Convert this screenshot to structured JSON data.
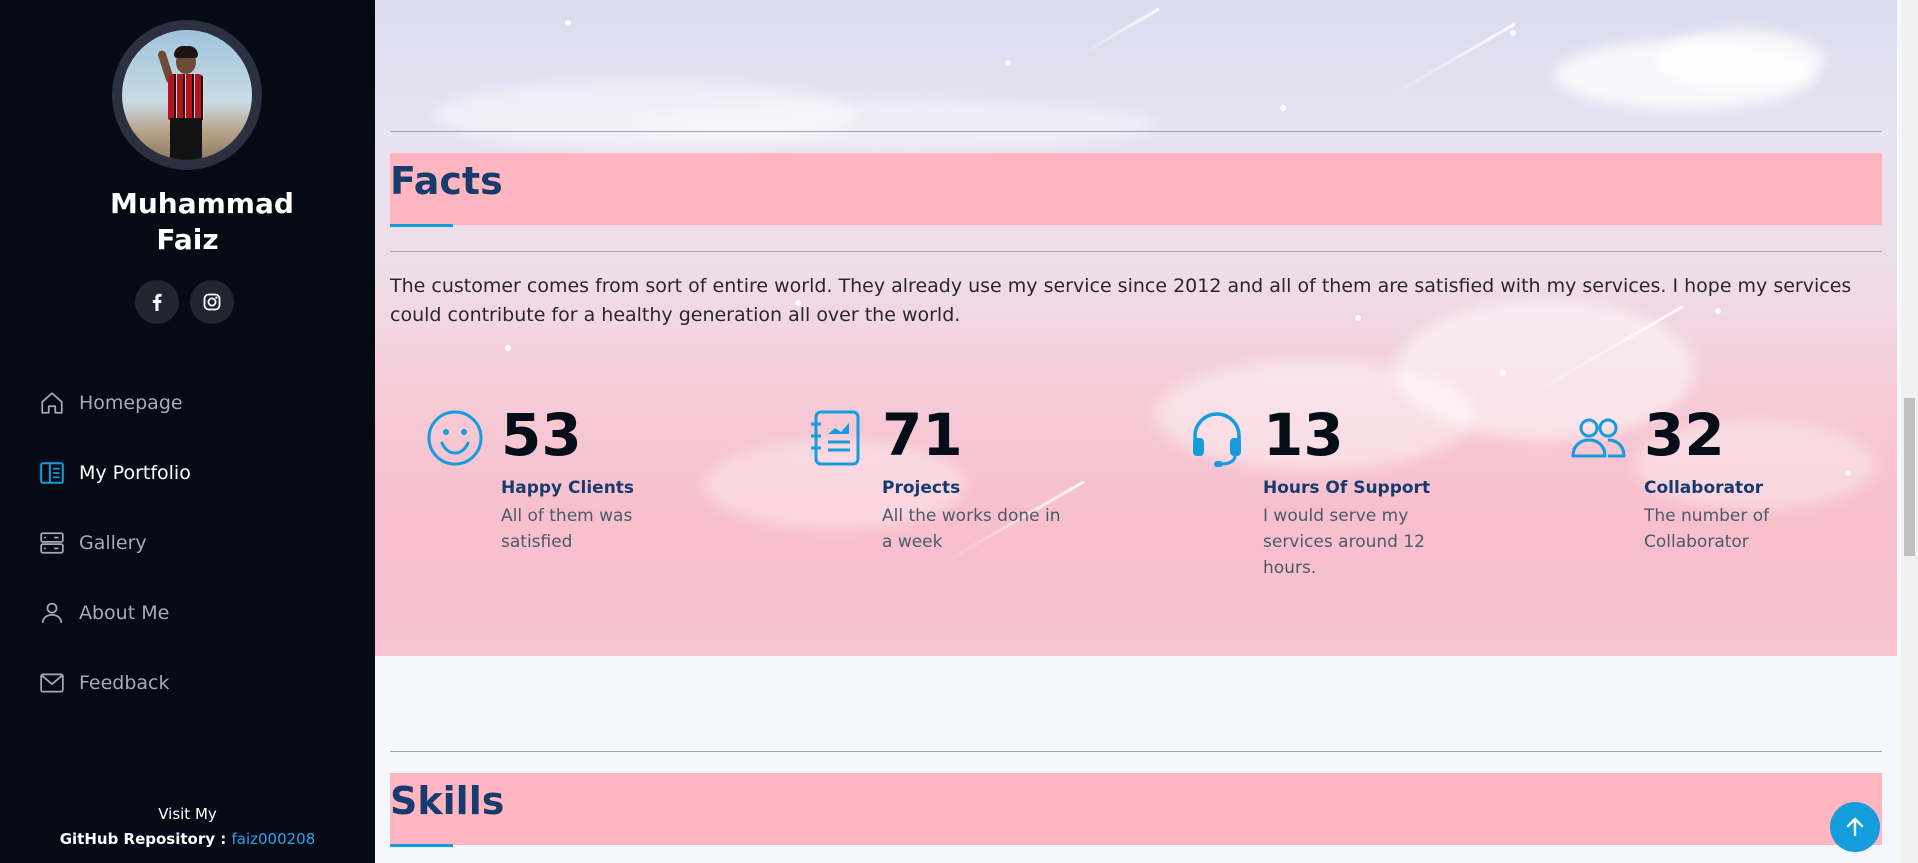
{
  "sidebar": {
    "name": "Muhammad Faiz",
    "social": [
      "facebook-icon",
      "instagram-icon"
    ],
    "nav": [
      {
        "label": "Homepage",
        "icon": "home-icon",
        "active": false
      },
      {
        "label": "My Portfolio",
        "icon": "portfolio-icon",
        "active": true
      },
      {
        "label": "Gallery",
        "icon": "gallery-icon",
        "active": false
      },
      {
        "label": "About Me",
        "icon": "person-icon",
        "active": false
      },
      {
        "label": "Feedback",
        "icon": "envelope-icon",
        "active": false
      }
    ],
    "footer": {
      "line1": "Visit My",
      "line2": "GitHub Repository :",
      "repo_link": "faiz000208"
    }
  },
  "facts": {
    "title": "Facts",
    "description": "The customer comes from sort of entire world. They already use my service since 2012 and all of them are satisfied with my services. I hope my services could contribute for a healthy generation all over the world.",
    "items": [
      {
        "icon": "smiley-icon",
        "number": "53",
        "title": "Happy Clients",
        "desc": "All of them was satisfied"
      },
      {
        "icon": "journal-chart-icon",
        "number": "71",
        "title": "Projects",
        "desc": "All the works done in a week"
      },
      {
        "icon": "headset-icon",
        "number": "13",
        "title": "Hours Of Support",
        "desc": "I would serve my services around 12 hours."
      },
      {
        "icon": "people-icon",
        "number": "32",
        "title": "Collaborator",
        "desc": "The number of Collaborator"
      }
    ]
  },
  "skills": {
    "title": "Skills"
  },
  "colors": {
    "accent": "#149ddd",
    "sidebar_bg": "#040b14",
    "title_bar": "#ffb6c1",
    "heading": "#173b6c"
  }
}
